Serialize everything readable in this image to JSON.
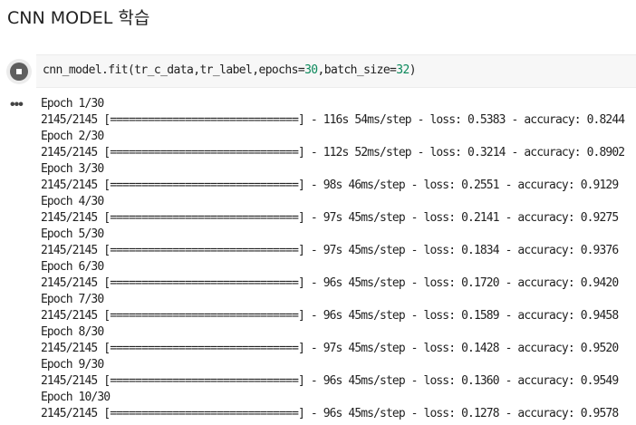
{
  "section": {
    "title": "CNN MODEL 학습"
  },
  "code_cell": {
    "run_icon": "stop-circle-icon",
    "code_prefix": "cnn_model.fit(tr_c_data,tr_label,epochs=",
    "epochs_value": "30",
    "code_middle": ",batch_size=",
    "batch_value": "32",
    "code_suffix": ")"
  },
  "output": {
    "menu_icon": "more-horiz-icon",
    "lines": [
      "Epoch 1/30",
      "2145/2145 [==============================] - 116s 54ms/step - loss: 0.5383 - accuracy: 0.8244",
      "Epoch 2/30",
      "2145/2145 [==============================] - 112s 52ms/step - loss: 0.3214 - accuracy: 0.8902",
      "Epoch 3/30",
      "2145/2145 [==============================] - 98s 46ms/step - loss: 0.2551 - accuracy: 0.9129",
      "Epoch 4/30",
      "2145/2145 [==============================] - 97s 45ms/step - loss: 0.2141 - accuracy: 0.9275",
      "Epoch 5/30",
      "2145/2145 [==============================] - 97s 45ms/step - loss: 0.1834 - accuracy: 0.9376",
      "Epoch 6/30",
      "2145/2145 [==============================] - 96s 45ms/step - loss: 0.1720 - accuracy: 0.9420",
      "Epoch 7/30",
      "2145/2145 [==============================] - 96s 45ms/step - loss: 0.1589 - accuracy: 0.9458",
      "Epoch 8/30",
      "2145/2145 [==============================] - 97s 45ms/step - loss: 0.1428 - accuracy: 0.9520",
      "Epoch 9/30",
      "2145/2145 [==============================] - 96s 45ms/step - loss: 0.1360 - accuracy: 0.9549",
      "Epoch 10/30",
      "2145/2145 [==============================] - 96s 45ms/step - loss: 0.1278 - accuracy: 0.9578"
    ]
  }
}
